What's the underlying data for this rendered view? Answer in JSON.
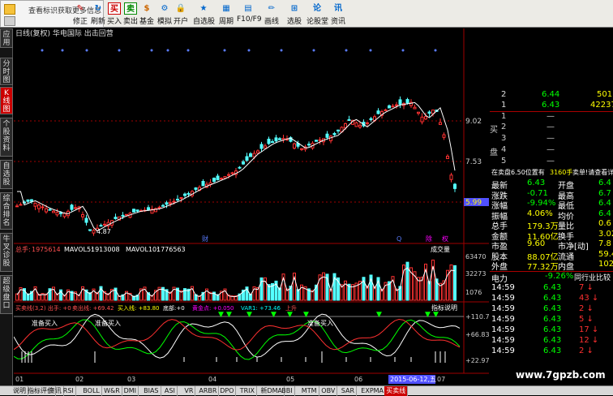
{
  "toolbar": {
    "tip": "查看标识获取更多信息",
    "buttons": [
      "修正",
      "刷新",
      "买入",
      "卖出",
      "基金",
      "模拟",
      "开户",
      "自选股",
      "周期",
      "F10/F9",
      "画线",
      "选股",
      "论股堂",
      "资讯"
    ]
  },
  "sidebar": {
    "tabs": [
      "应用",
      "分时图",
      "K线图",
      "个股资料",
      "自选股",
      "综合排名",
      "牛叉诊股",
      "超级盘口"
    ],
    "active": 2
  },
  "chart": {
    "header": "日线(复权) 华电国际 出击回营",
    "price_levels": [
      "9.02",
      "7.53",
      "5.99"
    ],
    "low_label": "4.87",
    "vol_header": {
      "name": "总手:",
      "value": "1975614",
      "mav5_label": "MAVOL5:",
      "mav5": "1913008",
      "mav10_label": "MAVOL10:",
      "mav10": "1776563",
      "title": "成交量"
    },
    "vol_levels": [
      "63470",
      "32273",
      "1076"
    ],
    "ind_header": [
      "买卖线(3,2) 出手: +0",
      "卖出线: +69.42",
      "买入线: +83.80",
      "底部:+0",
      "黄金点: +0.050",
      "VAR1: +73.46",
      "上升"
    ],
    "ind_title": "指标说明",
    "ind_levels": [
      "+110.7",
      "+66.83",
      "+22.97"
    ],
    "ind_labels": [
      "准备买入",
      "准备买入",
      "准备买入"
    ],
    "markers": [
      "财",
      "Q",
      "除",
      "权"
    ],
    "dates": [
      "01",
      "02",
      "03",
      "04",
      "05",
      "06",
      "07"
    ],
    "current_date": "2015-06-12,五"
  },
  "chart_data": {
    "type": "candlestick",
    "ylabel": "",
    "y_ticks": [
      9.02,
      7.53,
      5.99
    ],
    "low": 4.87,
    "high": 9.8,
    "x_ticks": [
      "01",
      "02",
      "03",
      "04",
      "05",
      "06",
      "07"
    ]
  },
  "right_panel": {
    "ask_rows": [
      [
        "2",
        "6.44",
        "501"
      ],
      [
        "1",
        "6.43",
        "42237"
      ]
    ],
    "bid_label": [
      "买",
      "盘"
    ],
    "bid_rows": [
      [
        "1",
        "—"
      ],
      [
        "2",
        "—"
      ],
      [
        "3",
        "—"
      ],
      [
        "4",
        "—"
      ],
      [
        "5",
        "—"
      ]
    ],
    "sell_info": "在卖盘6.50位置有",
    "sell_qty": "3160手",
    "sell_tail": "卖单!请查看详",
    "stats": [
      [
        "最新",
        "6.43",
        "开盘",
        "6.4"
      ],
      [
        "涨跌",
        "-0.71",
        "最高",
        "6.7"
      ],
      [
        "涨幅",
        "-9.94%",
        "最低",
        "6.4"
      ],
      [
        "振幅",
        "4.06%",
        "均价",
        "6.4"
      ],
      [
        "总手",
        "179.3万",
        "量比",
        "0.6"
      ],
      [
        "金额",
        "11.60亿",
        "换手",
        "3.02"
      ],
      [
        "市盈",
        "9.60",
        "市净[动]",
        "7.8"
      ],
      [
        "股本",
        "88.07亿",
        "流通",
        "59.40("
      ],
      [
        "外盘",
        "77.32万",
        "内盘",
        "102.0"
      ]
    ],
    "sector": "电力",
    "sector_pct": "-9.26%",
    "sector_tag": "同行业比较",
    "ticks": [
      [
        "14:59",
        "6.43",
        "7"
      ],
      [
        "14:59",
        "6.43",
        "43"
      ],
      [
        "14:59",
        "6.43",
        "2"
      ],
      [
        "14:59",
        "6.43",
        "5"
      ],
      [
        "14:59",
        "6.43",
        "17"
      ],
      [
        "14:59",
        "6.43",
        "12"
      ],
      [
        "14:59",
        "6.43",
        "2"
      ]
    ]
  },
  "bottom_tabs": [
    "说明",
    "指标评价",
    "资讯",
    "RSI",
    "BOLL",
    "W&R",
    "DMI",
    "BIAS",
    "ASI",
    "VR",
    "ARBR",
    "DPO",
    "TRIX",
    "新DMA",
    "BBI",
    "MTM",
    "OBV",
    "SAR",
    "EXPMA",
    "买卖线"
  ],
  "bottom_active": 19,
  "watermark": "www.7gpzb.com",
  "colors": {
    "up": "#ff3232",
    "down": "#54ffff",
    "ma": "#ffffff",
    "grid": "#a00000"
  }
}
